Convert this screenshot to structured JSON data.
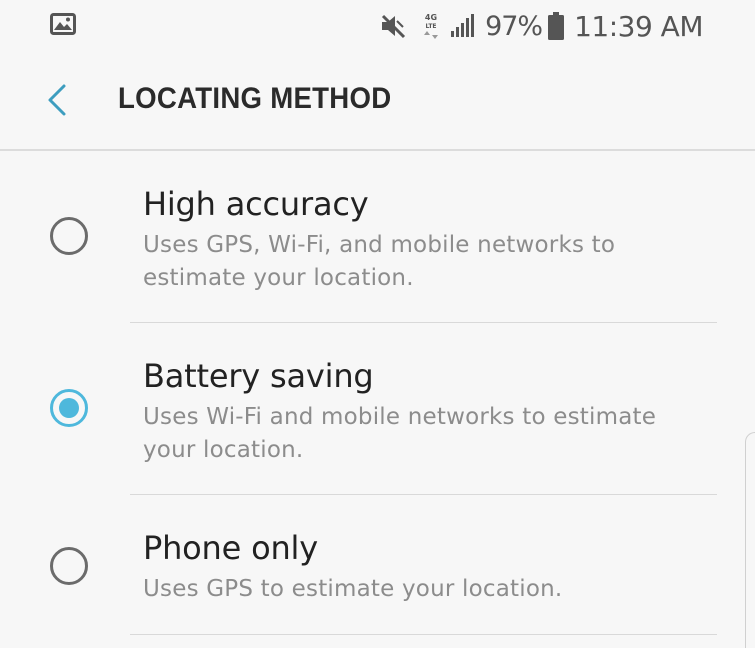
{
  "status_bar": {
    "gallery_icon": "image-icon",
    "mute_icon": "mute-icon",
    "network_label": "4G LTE",
    "signal_icon": "signal-icon",
    "battery_percent": "97%",
    "battery_icon": "battery-icon",
    "time": "11:39 AM"
  },
  "header": {
    "back_icon": "chevron-left-icon",
    "title": "LOCATING METHOD"
  },
  "options": [
    {
      "title": "High accuracy",
      "description": "Uses GPS, Wi-Fi, and mobile networks to estimate your location.",
      "selected": false
    },
    {
      "title": "Battery saving",
      "description": "Uses Wi-Fi and mobile networks to estimate your location.",
      "selected": true
    },
    {
      "title": "Phone only",
      "description": "Uses GPS to estimate your location.",
      "selected": false
    }
  ],
  "colors": {
    "accent": "#4eb8dc",
    "background": "#f7f7f7",
    "secondary_text": "#8c8c8c"
  }
}
